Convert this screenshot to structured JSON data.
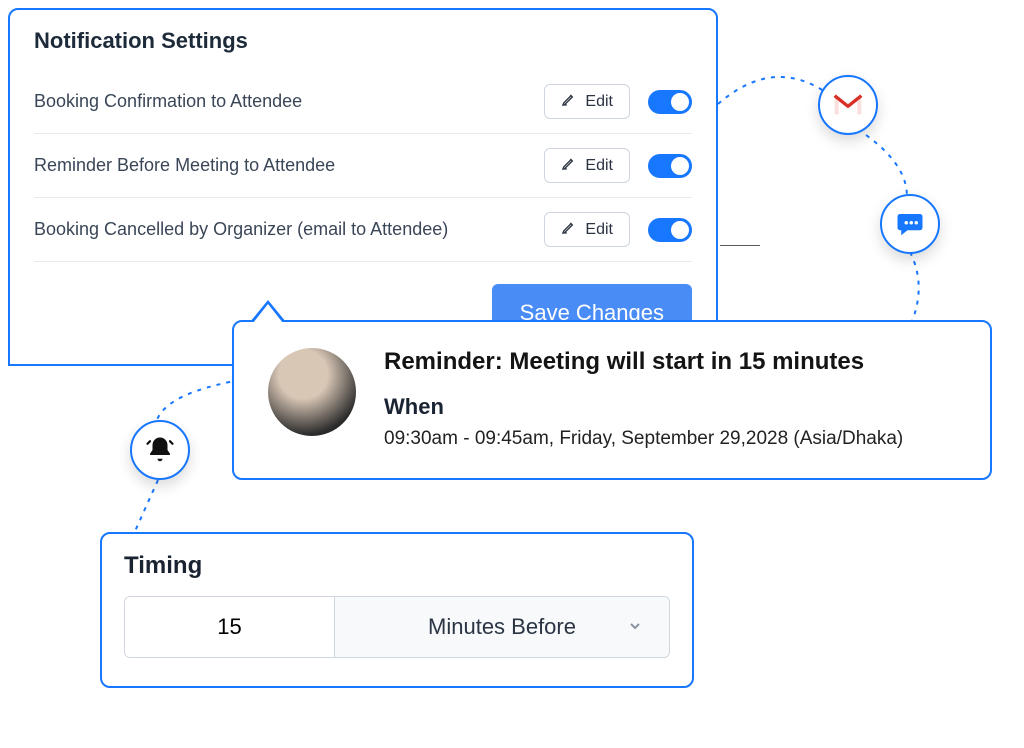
{
  "settings": {
    "title": "Notification Settings",
    "edit_label": "Edit",
    "items": [
      {
        "label": "Booking Confirmation to Attendee"
      },
      {
        "label": "Reminder Before Meeting to Attendee"
      },
      {
        "label": "Booking Cancelled by Organizer (email to Attendee)"
      }
    ],
    "save_label": "Save Changes"
  },
  "reminder": {
    "title": "Reminder: Meeting will start in 15 minutes",
    "when_label": "When",
    "when_value": "09:30am  - 09:45am, Friday, September 29,2028 (Asia/Dhaka)"
  },
  "timing": {
    "title": "Timing",
    "value": "15",
    "unit": "Minutes Before"
  },
  "icons": {
    "mail": "gmail-icon",
    "chat": "chat-bubble-icon",
    "bell": "bell-icon"
  }
}
